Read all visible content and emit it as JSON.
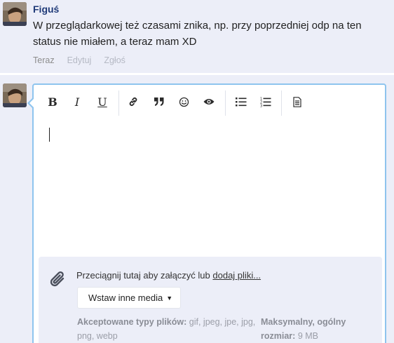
{
  "comment": {
    "author": "Figuś",
    "text": "W przeglądarkowej też czasami znika, np. przy poprzedniej odp na ten status nie miałem, a teraz mam XD",
    "time": "Teraz",
    "edit_label": "Edytuj",
    "report_label": "Zgłoś"
  },
  "editor": {
    "toolbar": [
      {
        "name": "bold",
        "icon": "bold-icon",
        "glyph": "B"
      },
      {
        "name": "italic",
        "icon": "italic-icon",
        "glyph": "I"
      },
      {
        "name": "underline",
        "icon": "underline-icon",
        "glyph": "U"
      },
      {
        "name": "link",
        "icon": "link-icon"
      },
      {
        "name": "quote",
        "icon": "quote-icon"
      },
      {
        "name": "emoji",
        "icon": "smiley-icon"
      },
      {
        "name": "preview",
        "icon": "eye-icon"
      },
      {
        "name": "bullet-list",
        "icon": "bullet-list-icon"
      },
      {
        "name": "numbered-list",
        "icon": "numbered-list-icon"
      },
      {
        "name": "source",
        "icon": "document-icon"
      }
    ]
  },
  "attachments": {
    "drop_text": "Przeciągnij tutaj aby załączyć lub",
    "add_files_link": "dodaj pliki...",
    "media_button": "Wstaw inne media",
    "accepted_label": "Akceptowane typy plików:",
    "accepted_types": "gif, jpeg, jpe, jpg, png, webp",
    "max_size_label": "Maksymalny, ogólny rozmiar:",
    "max_size_value": "9 MB"
  },
  "colors": {
    "background": "#eceef8",
    "author": "#1f3a78",
    "editor_border": "#8ec4ee"
  }
}
